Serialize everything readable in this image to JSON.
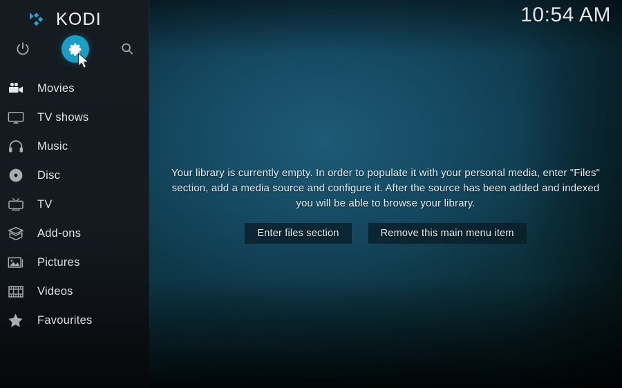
{
  "app": {
    "brand_name": "KODI",
    "logo_icon": "kodi-diamond-logo"
  },
  "clock": {
    "time": "10:54 AM"
  },
  "top_actions": [
    {
      "name": "power",
      "icon": "power-icon",
      "label": "Power"
    },
    {
      "name": "settings",
      "icon": "gear-icon",
      "label": "Settings",
      "selected": true,
      "accent": "#1c9ec4"
    },
    {
      "name": "search",
      "icon": "search-icon",
      "label": "Search"
    }
  ],
  "sidebar": {
    "items": [
      {
        "label": "Movies",
        "icon": "movie-camera-icon"
      },
      {
        "label": "TV shows",
        "icon": "tv-monitor-icon"
      },
      {
        "label": "Music",
        "icon": "headphones-icon"
      },
      {
        "label": "Disc",
        "icon": "disc-icon"
      },
      {
        "label": "TV",
        "icon": "television-antenna-icon"
      },
      {
        "label": "Add-ons",
        "icon": "open-box-icon"
      },
      {
        "label": "Pictures",
        "icon": "picture-icon"
      },
      {
        "label": "Videos",
        "icon": "film-strip-icon"
      },
      {
        "label": "Favourites",
        "icon": "star-icon"
      }
    ]
  },
  "main": {
    "empty_message": "Your library is currently empty. In order to populate it with your personal media, enter \"Files\" section, add a media source and configure it. After the source has been added and indexed you will be able to browse your library.",
    "buttons": {
      "enter_files": "Enter files section",
      "remove_item": "Remove this main menu item"
    }
  },
  "cursor": {
    "icon": "mouse-pointer-icon"
  },
  "colors": {
    "accent": "#1c9ec4",
    "sidebar_bg": "#141a20",
    "backdrop_teal": "#124054",
    "text_primary": "#e2eaee"
  }
}
